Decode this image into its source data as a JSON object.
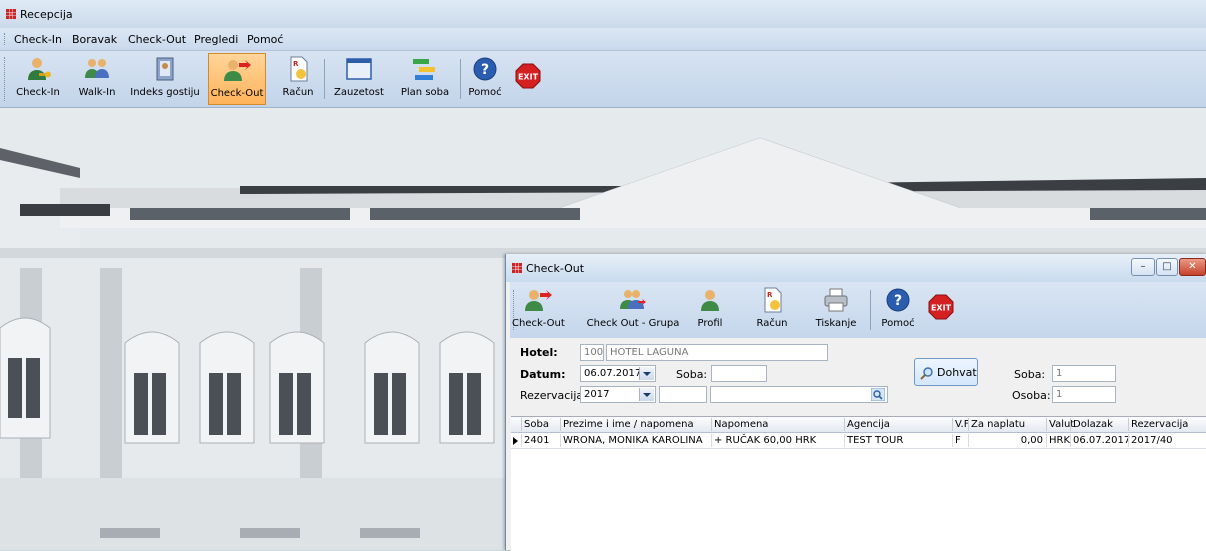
{
  "app": {
    "title": "Recepcija"
  },
  "menu": [
    "Check-In",
    "Boravak",
    "Check-Out",
    "Pregledi",
    "Pomoć"
  ],
  "toolbar": [
    {
      "label": "Check-In",
      "icon": "person-key-icon"
    },
    {
      "label": "Walk-In",
      "icon": "walking-people-icon"
    },
    {
      "label": "Indeks gostiju",
      "icon": "guest-index-book-icon"
    },
    {
      "label": "Check-Out",
      "icon": "checkout-person-arrow-icon",
      "active": true
    },
    {
      "label": "Račun",
      "icon": "invoice-document-icon"
    },
    {
      "label": "Zauzetost",
      "icon": "occupancy-window-icon"
    },
    {
      "label": "Plan soba",
      "icon": "room-plan-bars-icon"
    },
    {
      "label": "Pomoć",
      "icon": "help-icon"
    },
    {
      "label": "EXIT",
      "icon": "exit-icon"
    }
  ],
  "checkout_window": {
    "title": "Check-Out",
    "toolbar": [
      {
        "label": "Check-Out",
        "icon": "checkout-person-arrow-icon"
      },
      {
        "label": "Check Out - Grupa",
        "icon": "group-checkout-icon"
      },
      {
        "label": "Profil",
        "icon": "profile-person-icon"
      },
      {
        "label": "Račun",
        "icon": "invoice-document-icon"
      },
      {
        "label": "Tiskanje",
        "icon": "printer-icon"
      },
      {
        "label": "Pomoć",
        "icon": "help-icon"
      },
      {
        "label": "EXIT",
        "icon": "exit-icon"
      }
    ],
    "form": {
      "hotel_label": "Hotel:",
      "hotel_code": "100",
      "hotel_name": "HOTEL LAGUNA",
      "datum_label": "Datum:",
      "datum_value": "06.07.2017",
      "soba_label": "Soba:",
      "soba_value": "",
      "rezervacija_label": "Rezervacija:",
      "rezervacija_year": "2017",
      "rezervacija_number": "",
      "rezervacija_search": "",
      "dohvat_label": "Dohvat",
      "soba_count_label": "Soba:",
      "soba_count_value": "1",
      "osoba_label": "Osoba:",
      "osoba_value": "1"
    },
    "grid": {
      "columns": [
        "Soba",
        "Prezime i ime / napomena",
        "Napomena",
        "Agencija",
        "V.F",
        "Za naplatu",
        "Valut",
        "Dolazak",
        "Rezervacija"
      ],
      "rows": [
        [
          "2401",
          "WRONA, MONIKA KAROLINA",
          "+ RUČAK 60,00 HRK",
          "TEST TOUR",
          "F",
          "0,00",
          "HRK",
          "06.07.2017",
          "2017/40"
        ]
      ]
    }
  },
  "colors": {
    "active_button": "#ffb35a",
    "toolbar": "#c9d9ec",
    "exit_red": "#d42020",
    "help_blue": "#2a5db0"
  }
}
